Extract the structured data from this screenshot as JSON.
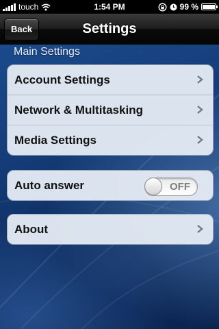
{
  "status_bar": {
    "carrier": "touch",
    "time": "1:54 PM",
    "battery_percent": "99 %",
    "battery_level": 0.99
  },
  "nav": {
    "back_label": "Back",
    "title": "Settings"
  },
  "main_settings": {
    "header": "Main Settings",
    "items": [
      {
        "label": "Account Settings",
        "icon": "chevron-right-icon"
      },
      {
        "label": "Network & Multitasking",
        "icon": "chevron-right-icon"
      },
      {
        "label": "Media Settings",
        "icon": "chevron-right-icon"
      }
    ]
  },
  "auto_answer": {
    "label": "Auto answer",
    "toggle_text": "OFF",
    "enabled": false
  },
  "about": {
    "label": "About",
    "icon": "chevron-right-icon"
  },
  "colors": {
    "nav_bar": "#1c1c1c",
    "background": "#163f7c",
    "cell": "#e6ecf4"
  }
}
